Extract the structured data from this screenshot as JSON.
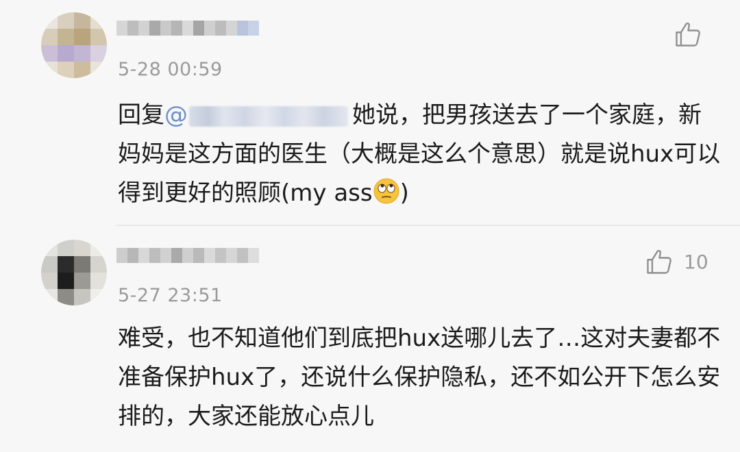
{
  "comments": [
    {
      "timestamp": "5-28 00:59",
      "like_count": "",
      "reply_prefix": "回复",
      "mention_symbol": "@",
      "mention_name": "",
      "text_after_mention": "她说，把男孩送去了一个家庭，新妈妈是这方面的医生（大概是这么个意思）就是说hux可以得到更好的照顾(my ass",
      "emoji_name": "face-with-rolling-eyes-emoji",
      "text_end": ")"
    },
    {
      "timestamp": "5-27 23:51",
      "like_count": "10",
      "text": "难受，也不知道他们到底把hux送哪儿去了…这对夫妻都不准备保护hux了，还说什么保护隐私，还不如公开下怎么安排的，大家还能放心点儿"
    }
  ],
  "icons": {
    "like": "thumbs-up-icon"
  },
  "colors": {
    "background": "#f7f7f7",
    "text": "#1b1b1b",
    "meta": "#9a9a9a",
    "mention": "#6f8fc8",
    "divider": "#e9e9e9"
  }
}
